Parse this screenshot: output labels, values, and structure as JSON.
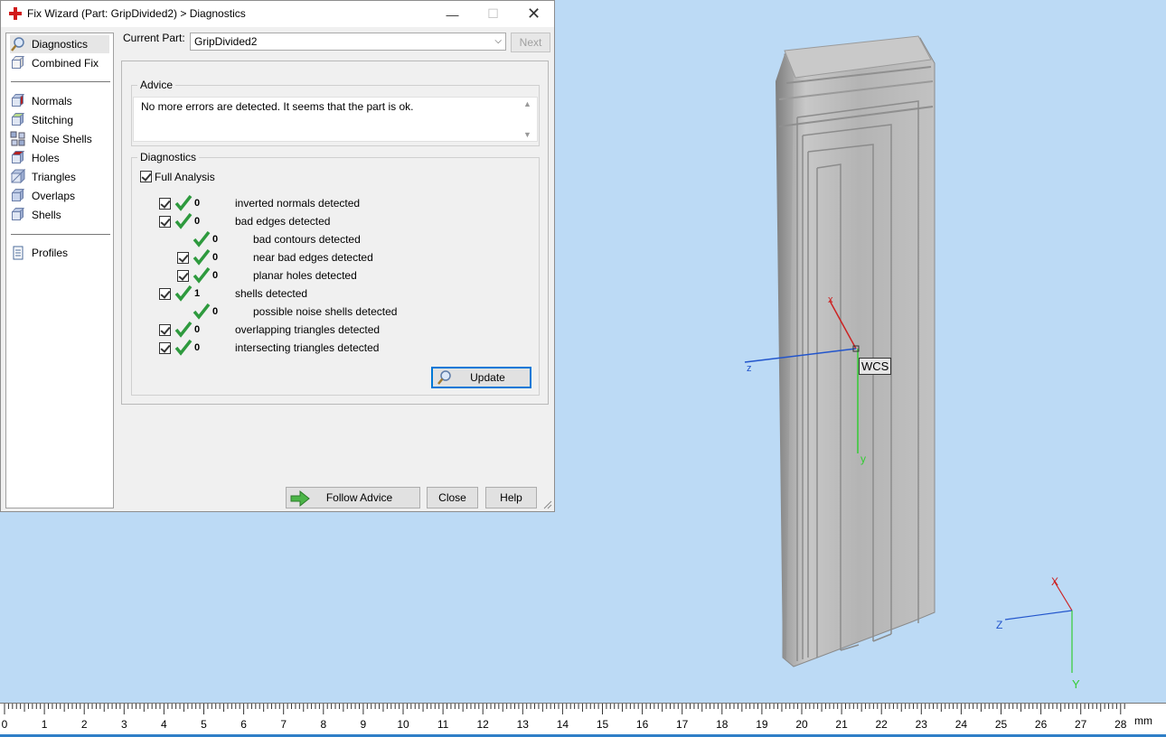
{
  "window": {
    "title": "Fix Wizard (Part: GripDivided2) > Diagnostics",
    "minimize_glyph": "—",
    "maximize_glyph": "☐",
    "close_glyph": "✕"
  },
  "sidebar": {
    "items": [
      {
        "label": "Diagnostics",
        "icon": "magnifier-icon",
        "selected": true
      },
      {
        "label": "Combined Fix",
        "icon": "cube-icon"
      },
      {
        "label": "Normals",
        "icon": "normals-cube-icon"
      },
      {
        "label": "Stitching",
        "icon": "stitching-cube-icon"
      },
      {
        "label": "Noise Shells",
        "icon": "noise-shells-icon"
      },
      {
        "label": "Holes",
        "icon": "holes-cube-icon"
      },
      {
        "label": "Triangles",
        "icon": "triangles-cube-icon"
      },
      {
        "label": "Overlaps",
        "icon": "overlaps-cube-icon"
      },
      {
        "label": "Shells",
        "icon": "shells-cube-icon"
      },
      {
        "label": "Profiles",
        "icon": "document-icon"
      }
    ]
  },
  "header": {
    "current_part_label": "Current Part:",
    "current_part_value": "GripDivided2",
    "next_label": "Next"
  },
  "advice": {
    "title": "Advice",
    "text": "No more errors are detected. It seems that the part is ok."
  },
  "diagnostics": {
    "title": "Diagnostics",
    "full_analysis_label": "Full Analysis",
    "rows": [
      {
        "count": "0",
        "label": "inverted normals detected"
      },
      {
        "count": "0",
        "label": "bad edges detected"
      },
      {
        "count": "0",
        "label": "bad contours detected"
      },
      {
        "count": "0",
        "label": "near bad edges detected"
      },
      {
        "count": "0",
        "label": "planar holes detected"
      },
      {
        "count": "1",
        "label": "shells detected"
      },
      {
        "count": "0",
        "label": "possible noise shells detected"
      },
      {
        "count": "0",
        "label": "overlapping triangles detected"
      },
      {
        "count": "0",
        "label": "intersecting triangles detected"
      }
    ],
    "update_label": "Update"
  },
  "footer": {
    "follow_advice_label": "Follow Advice",
    "close_label": "Close",
    "help_label": "Help"
  },
  "viewport": {
    "wcs_label": "WCS",
    "axis_x": "x",
    "axis_y": "y",
    "axis_z": "z",
    "triad_x": "X",
    "triad_y": "Y",
    "triad_z": "Z"
  },
  "ruler": {
    "ticks": [
      "0",
      "1",
      "2",
      "3",
      "4",
      "5",
      "6",
      "7",
      "8",
      "9",
      "10",
      "11",
      "12",
      "13",
      "14",
      "15",
      "16",
      "17",
      "18",
      "19",
      "20",
      "21",
      "22",
      "23",
      "24",
      "25",
      "26",
      "27",
      "28"
    ],
    "unit": "mm"
  },
  "colors": {
    "background": "#bcdaf5",
    "check_green": "#2e9a3e",
    "axis_red": "#cc2222",
    "axis_green": "#33cc33",
    "axis_blue": "#2255cc"
  }
}
